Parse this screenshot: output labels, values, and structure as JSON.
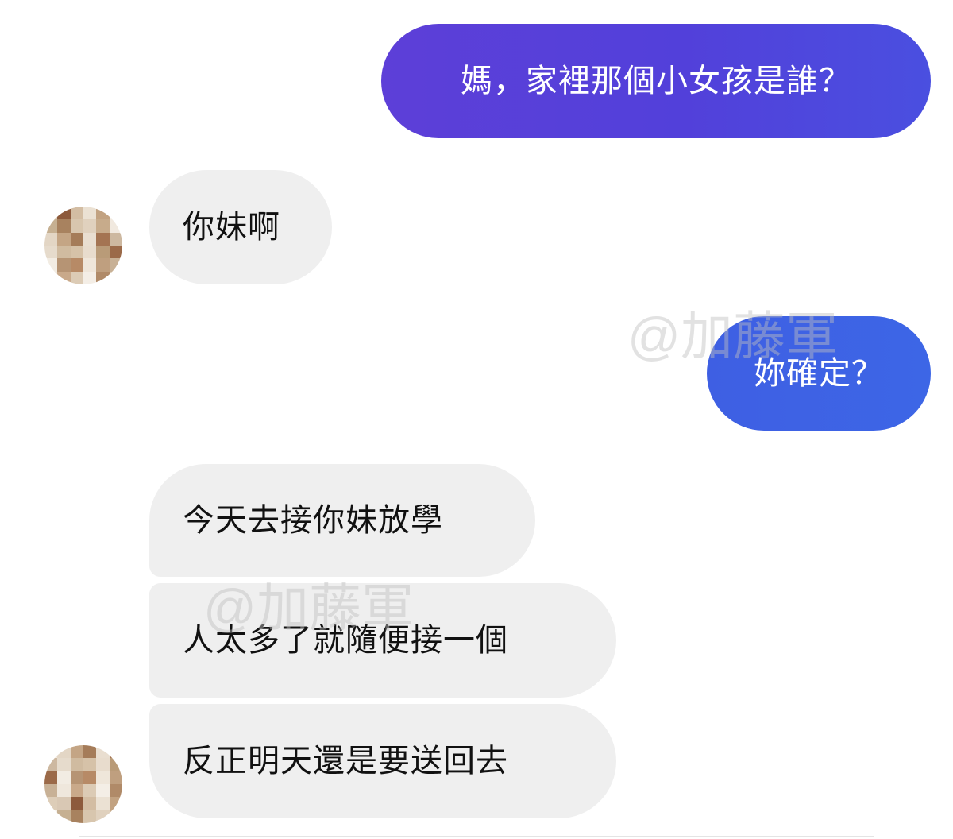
{
  "conversation": {
    "messages": [
      {
        "sender": "me",
        "text": "媽，家裡那個小女孩是誰？"
      },
      {
        "sender": "mom",
        "text": "你妹啊"
      },
      {
        "sender": "me",
        "text": "妳確定？"
      },
      {
        "sender": "mom",
        "text": "今天去接你妹放學"
      },
      {
        "sender": "mom",
        "text": "人太多了就隨便接一個"
      },
      {
        "sender": "mom",
        "text": "反正明天還是要送回去"
      }
    ]
  },
  "watermark": {
    "text": "@加藤軍"
  },
  "colors": {
    "outgoing_bubble_1": "#5545d9",
    "outgoing_bubble_2": "#3e62e4",
    "incoming_bubble": "#efefef",
    "text_dark": "#111111",
    "text_light": "#ffffff"
  },
  "avatar": {
    "icon": "pixelated-avatar-icon"
  }
}
